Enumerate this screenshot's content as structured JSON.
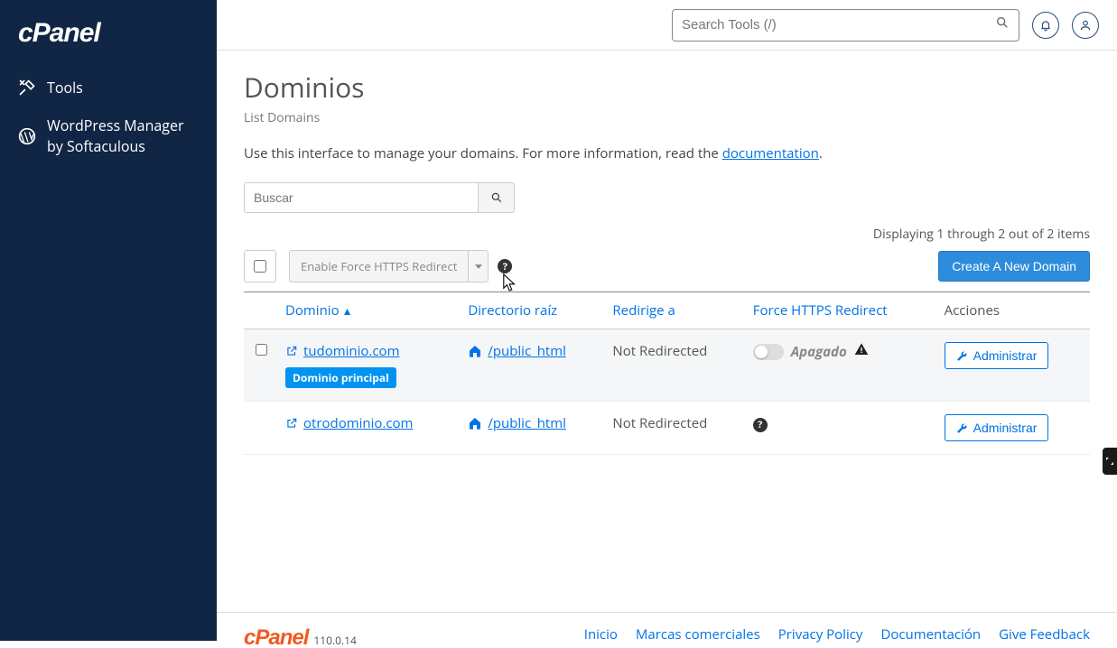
{
  "brand": "cPanel",
  "sidebar": {
    "items": [
      {
        "label": "Tools",
        "icon": "tools-icon"
      },
      {
        "label": "WordPress Manager by Softaculous",
        "icon": "wordpress-icon"
      }
    ]
  },
  "topbar": {
    "search_placeholder": "Search Tools (/)"
  },
  "page": {
    "title": "Dominios",
    "breadcrumb": "List Domains",
    "description_pre": "Use this interface to manage your domains. For more information, read the ",
    "description_link": "documentation",
    "description_post": "."
  },
  "searchbox": {
    "placeholder": "Buscar"
  },
  "displaying_text": "Displaying 1 through 2 out of 2 items",
  "toolbar": {
    "https_button": "Enable Force HTTPS Redirect",
    "create_button": "Create A New Domain"
  },
  "columns": {
    "domain": "Dominio",
    "root": "Directorio raíz",
    "redirects": "Redirige a",
    "https": "Force HTTPS Redirect",
    "actions": "Acciones"
  },
  "rows": [
    {
      "domain": "tudominio.com",
      "badge": "Dominio principal",
      "root": "/public_html",
      "redirects": "Not Redirected",
      "https_state": "off",
      "https_label": "Apagado",
      "manage": "Administrar"
    },
    {
      "domain": "otrodominio.com",
      "badge": "",
      "root": "/public_html",
      "redirects": "Not Redirected",
      "https_state": "unknown",
      "https_label": "",
      "manage": "Administrar"
    }
  ],
  "footer": {
    "logo": "cPanel",
    "version": "110.0.14",
    "links": [
      "Inicio",
      "Marcas comerciales",
      "Privacy Policy",
      "Documentación",
      "Give Feedback"
    ]
  }
}
